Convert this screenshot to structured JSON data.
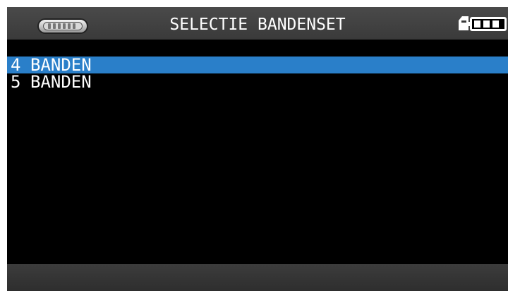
{
  "header": {
    "title": "SELECTIE BANDENSET",
    "logo_icon": "brand-logo-icon",
    "sd_card_icon": "sd-card-icon",
    "battery_icon": "battery-icon",
    "battery_bars": 3
  },
  "menu": {
    "items": [
      {
        "number": "4",
        "label": "BANDEN",
        "selected": true
      },
      {
        "number": "5",
        "label": "BANDEN",
        "selected": false
      }
    ]
  },
  "colors": {
    "selection": "#2a7fc9",
    "header_bg": "#3a3a3a",
    "screen_bg": "#000000"
  }
}
